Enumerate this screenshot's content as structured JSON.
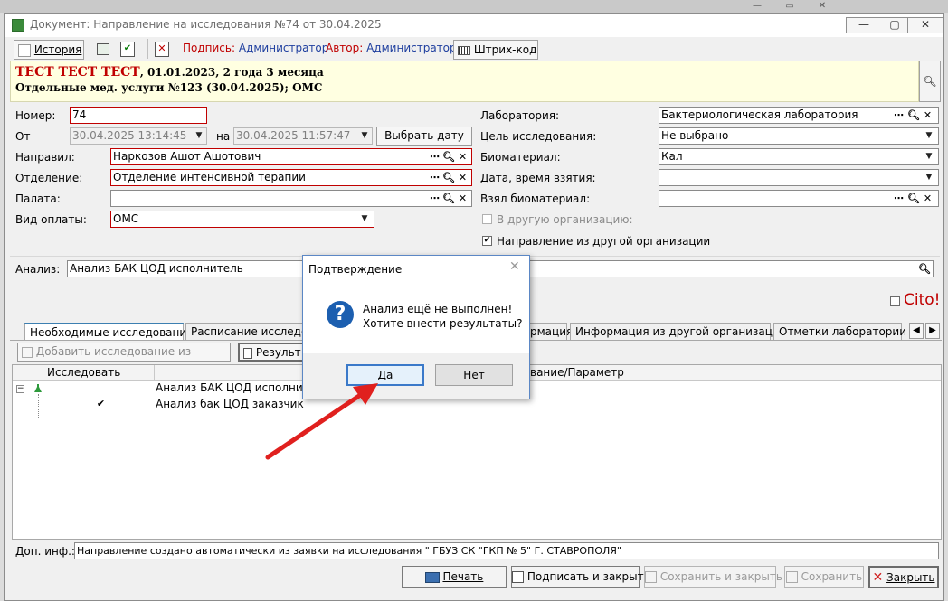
{
  "window": {
    "title": "Документ: Направление на исследования №74 от 30.04.2025",
    "min": "▭",
    "restore": "▢",
    "close": "✕"
  },
  "toolbar": {
    "history": "История",
    "sign_label": "Подпись:",
    "sign_value": "Администратор",
    "author_label": "Автор:",
    "author_value": "Администратор",
    "barcode": "Штрих-код"
  },
  "patient": {
    "name": "ТЕСТ ТЕСТ ТЕСТ",
    "details": ", 01.01.2023, 2 года 3 месяца",
    "service": "Отдельные мед. услуги №123 (30.04.2025); ОМС"
  },
  "form": {
    "number_label": "Номер:",
    "number_value": "74",
    "from_label": "От",
    "from_value": "30.04.2025 13:14:45",
    "to_label": "на",
    "to_value": "30.04.2025 11:57:47",
    "choose_date": "Выбрать дату",
    "sent_by_label": "Направил:",
    "sent_by_value": "Наркозов Ашот Ашотович",
    "dept_label": "Отделение:",
    "dept_value": "Отделение интенсивной терапии",
    "ward_label": "Палата:",
    "ward_value": "",
    "payment_label": "Вид оплаты:",
    "payment_value": "ОМС",
    "lab_label": "Лаборатория:",
    "lab_value": "Бактериологическая лаборатория",
    "purpose_label": "Цель исследования:",
    "purpose_value": "Не выбрано",
    "biomaterial_label": "Биоматериал:",
    "biomaterial_value": "Кал",
    "taken_dt_label": "Дата, время взятия:",
    "taken_dt_value": "",
    "taken_by_label": "Взял биоматериал:",
    "taken_by_value": "",
    "other_org_label": "В другую организацию:",
    "from_other_org_label": "Направление из другой организации",
    "analysis_label": "Анализ:",
    "analysis_value": "Анализ БАК ЦОД исполнитель",
    "cito": "Cito!"
  },
  "tabs": [
    "Необходимые исследования",
    "Расписание исследо",
    "рмация",
    "Информация из другой организации",
    "Отметки лаборатории"
  ],
  "subtoolbar": {
    "add_from_ref": "Добавить исследование из справочника",
    "results": "Результ"
  },
  "grid": {
    "col1": "Исследовать",
    "col2": "вание/Параметр",
    "rows": [
      "Анализ БАК ЦОД исполнител",
      "Анализ бак ЦОД заказчик"
    ]
  },
  "dialog": {
    "title": "Подтверждение",
    "line1": "Анализ ещё не выполнен!",
    "line2": "Хотите внести результаты?",
    "yes": "Да",
    "no": "Нет"
  },
  "footer": {
    "extra_label": "Доп. инф.:",
    "extra_value": "Направление создано автоматически из заявки на исследования \" ГБУЗ СК \"ГКП № 5\" Г. СТАВРОПОЛЯ\"",
    "print": "Печать",
    "sign_close": "Подписать и закрыть",
    "save_close": "Сохранить и закрыть",
    "save": "Сохранить",
    "close": "Закрыть"
  },
  "colors": {
    "required_border": "#c00000",
    "patient_bg": "#ffffe1",
    "accent": "#3b79c9",
    "arrow": "#e0201e"
  }
}
